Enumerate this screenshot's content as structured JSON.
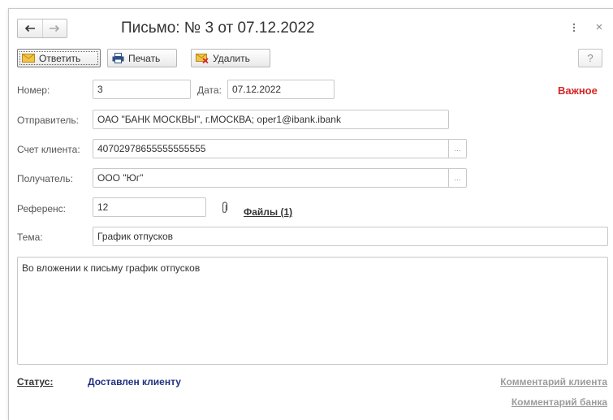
{
  "window": {
    "title": "Письмо: № 3 от 07.12.2022",
    "close_glyph": "×"
  },
  "toolbar": {
    "reply_label": "Ответить",
    "print_label": "Печать",
    "delete_label": "Удалить",
    "help_label": "?"
  },
  "form": {
    "number_label": "Номер:",
    "number_value": "3",
    "date_label": "Дата:",
    "date_value": "07.12.2022",
    "important_label": "Важное",
    "sender_label": "Отправитель:",
    "sender_value": "ОАО \"БАНК МОСКВЫ\", г.МОСКВА; oper1@ibank.ibank",
    "account_label": "Счет клиента:",
    "account_value": "40702978655555555555",
    "recipient_label": "Получатель:",
    "recipient_value": "ООО \"Юг\"",
    "reference_label": "Референс:",
    "reference_value": "12",
    "files_link": "Файлы (1)",
    "subject_label": "Тема:",
    "subject_value": "График отпусков",
    "body_text": "Во вложении к письму график отпусков",
    "select_glyph": "..."
  },
  "footer": {
    "status_label": "Статус:",
    "status_value": "Доставлен клиенту",
    "client_comment_link": "Комментарий клиента",
    "bank_comment_link": "Комментарий банка"
  },
  "colors": {
    "important": "#d42727",
    "status_value": "#1f2f80",
    "disabled_link": "#9c9c9c"
  }
}
